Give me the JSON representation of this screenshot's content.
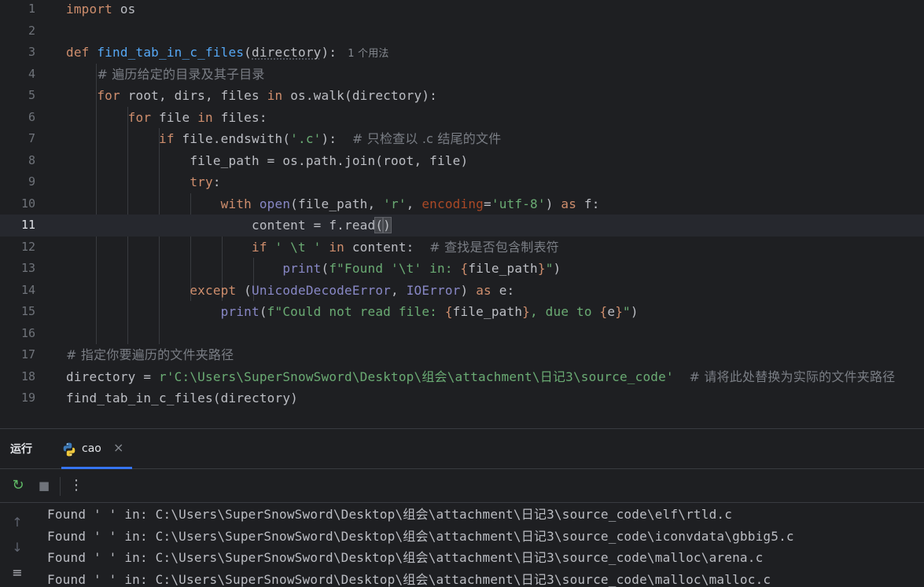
{
  "editor": {
    "lines": [
      {
        "num": "1",
        "tokens": [
          [
            "kw",
            "import"
          ],
          [
            "plain",
            " os"
          ]
        ]
      },
      {
        "num": "2",
        "tokens": []
      },
      {
        "num": "3",
        "tokens": [
          [
            "kw",
            "def "
          ],
          [
            "fn",
            "find_tab_in_c_files"
          ],
          [
            "plain",
            "("
          ],
          [
            "ul",
            "directory"
          ],
          [
            "plain",
            "):"
          ]
        ],
        "hint": "1 个用法"
      },
      {
        "num": "4",
        "tokens": [
          [
            "plain",
            "    "
          ],
          [
            "com",
            "# 遍历给定的目录及其子目录"
          ]
        ]
      },
      {
        "num": "5",
        "tokens": [
          [
            "plain",
            "    "
          ],
          [
            "kw",
            "for "
          ],
          [
            "plain",
            "root, dirs, files "
          ],
          [
            "kw",
            "in "
          ],
          [
            "plain",
            "os.walk(directory):"
          ]
        ]
      },
      {
        "num": "6",
        "tokens": [
          [
            "plain",
            "        "
          ],
          [
            "kw",
            "for "
          ],
          [
            "plain",
            "file "
          ],
          [
            "kw",
            "in "
          ],
          [
            "plain",
            "files:"
          ]
        ]
      },
      {
        "num": "7",
        "tokens": [
          [
            "plain",
            "            "
          ],
          [
            "kw",
            "if "
          ],
          [
            "plain",
            "file.endswith("
          ],
          [
            "str",
            "'.c'"
          ],
          [
            "plain",
            "):  "
          ],
          [
            "com",
            "# 只检查以 .c 结尾的文件"
          ]
        ]
      },
      {
        "num": "8",
        "tokens": [
          [
            "plain",
            "                file_path = os.path.join(root, file)"
          ]
        ]
      },
      {
        "num": "9",
        "tokens": [
          [
            "plain",
            "                "
          ],
          [
            "kw",
            "try"
          ],
          [
            "plain",
            ":"
          ]
        ]
      },
      {
        "num": "10",
        "tokens": [
          [
            "plain",
            "                    "
          ],
          [
            "kw",
            "with "
          ],
          [
            "bi",
            "open"
          ],
          [
            "plain",
            "(file_path, "
          ],
          [
            "str",
            "'r'"
          ],
          [
            "plain",
            ", "
          ],
          [
            "param",
            "encoding"
          ],
          [
            "plain",
            "="
          ],
          [
            "str",
            "'utf-8'"
          ],
          [
            "plain",
            ") "
          ],
          [
            "kw",
            "as "
          ],
          [
            "plain",
            "f:"
          ]
        ]
      },
      {
        "num": "11",
        "tokens": [
          [
            "plain",
            "                        content = f.read"
          ],
          [
            "br",
            "("
          ],
          [
            "br",
            ")"
          ]
        ],
        "current": true
      },
      {
        "num": "12",
        "tokens": [
          [
            "plain",
            "                        "
          ],
          [
            "kw",
            "if "
          ],
          [
            "str",
            "' \\t ' "
          ],
          [
            "kw",
            "in "
          ],
          [
            "plain",
            "content:  "
          ],
          [
            "com",
            "# 查找是否包含制表符"
          ]
        ]
      },
      {
        "num": "13",
        "tokens": [
          [
            "plain",
            "                            "
          ],
          [
            "bi",
            "print"
          ],
          [
            "plain",
            "("
          ],
          [
            "str",
            "f\"Found '\\t' in: "
          ],
          [
            "kw",
            "{"
          ],
          [
            "plain",
            "file_path"
          ],
          [
            "kw",
            "}"
          ],
          [
            "str",
            "\""
          ],
          [
            "plain",
            ")"
          ]
        ]
      },
      {
        "num": "14",
        "tokens": [
          [
            "plain",
            "                "
          ],
          [
            "kw",
            "except "
          ],
          [
            "plain",
            "("
          ],
          [
            "bi",
            "UnicodeDecodeError"
          ],
          [
            "plain",
            ", "
          ],
          [
            "bi",
            "IOError"
          ],
          [
            "plain",
            ") "
          ],
          [
            "kw",
            "as "
          ],
          [
            "plain",
            "e:"
          ]
        ]
      },
      {
        "num": "15",
        "tokens": [
          [
            "plain",
            "                    "
          ],
          [
            "bi",
            "print"
          ],
          [
            "plain",
            "("
          ],
          [
            "str",
            "f\"Could not read file: "
          ],
          [
            "kw",
            "{"
          ],
          [
            "plain",
            "file_path"
          ],
          [
            "kw",
            "}"
          ],
          [
            "str",
            ", due to "
          ],
          [
            "kw",
            "{"
          ],
          [
            "plain",
            "e"
          ],
          [
            "kw",
            "}"
          ],
          [
            "str",
            "\""
          ],
          [
            "plain",
            ")"
          ]
        ]
      },
      {
        "num": "16",
        "tokens": []
      },
      {
        "num": "17",
        "tokens": [
          [
            "com",
            "# 指定你要遍历的文件夹路径"
          ]
        ]
      },
      {
        "num": "18",
        "tokens": [
          [
            "plain",
            "directory = "
          ],
          [
            "str",
            "r'C:\\Users\\SuperSnowSword\\Desktop\\组会\\attachment\\日记3\\source_code'"
          ],
          [
            "plain",
            "  "
          ],
          [
            "com",
            "# 请将此处替换为实际的文件夹路径"
          ]
        ]
      },
      {
        "num": "19",
        "tokens": [
          [
            "plain",
            "find_tab_in_c_files(directory)"
          ]
        ]
      }
    ]
  },
  "run_panel": {
    "title": "运行",
    "tab_label": "cao",
    "close_glyph": "×",
    "rerun_glyph": "↻",
    "stop_glyph": "■",
    "more_glyph": "⋮",
    "up_glyph": "↑",
    "down_glyph": "↓",
    "wrap_glyph": "≡",
    "output": [
      "Found ' ' in: C:\\Users\\SuperSnowSword\\Desktop\\组会\\attachment\\日记3\\source_code\\elf\\rtld.c",
      "Found ' ' in: C:\\Users\\SuperSnowSword\\Desktop\\组会\\attachment\\日记3\\source_code\\iconvdata\\gbbig5.c",
      "Found ' ' in: C:\\Users\\SuperSnowSword\\Desktop\\组会\\attachment\\日记3\\source_code\\malloc\\arena.c",
      "Found ' ' in: C:\\Users\\SuperSnowSword\\Desktop\\组会\\attachment\\日记3\\source_code\\malloc\\malloc.c"
    ]
  },
  "colors": {
    "background": "#1e1f22",
    "keyword": "#cf8e6d",
    "function": "#56a8f5",
    "string": "#6aab73",
    "comment": "#7a7e85",
    "builtin": "#8888c6",
    "accent": "#3574f0"
  },
  "icons": [
    "python-icon",
    "close-icon",
    "rerun-icon",
    "stop-icon",
    "more-icon",
    "scroll-up-icon",
    "scroll-down-icon",
    "soft-wrap-icon"
  ]
}
